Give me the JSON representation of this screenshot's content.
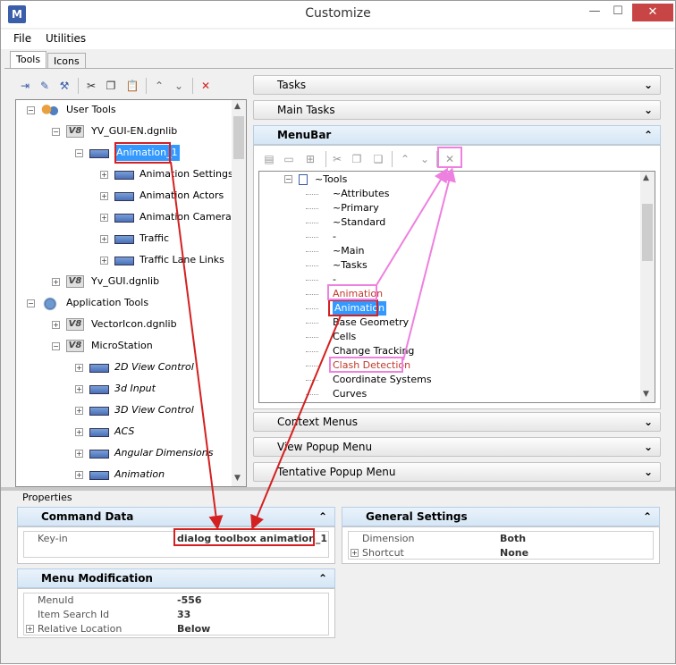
{
  "window": {
    "title": "Customize",
    "minimize": "—",
    "maximize": "☐",
    "close": "✕"
  },
  "menus": [
    "File",
    "Utilities"
  ],
  "tabs": [
    "Tools",
    "Icons"
  ],
  "left_tree": [
    {
      "label": "User Tools",
      "level": 0,
      "icon": "people-icon",
      "expander": "⊟"
    },
    {
      "label": "YV_GUI-EN.dgnlib",
      "level": 1,
      "icon": "v8-icon",
      "expander": "⊟"
    },
    {
      "label": "Animation_1",
      "level": 2,
      "icon": "toolbox-icon",
      "expander": "⊟",
      "selected": true
    },
    {
      "label": "Animation Settings",
      "level": 3,
      "icon": "toolbox-icon",
      "expander": "⊞"
    },
    {
      "label": "Animation Actors",
      "level": 3,
      "icon": "toolbox-icon",
      "expander": "⊞"
    },
    {
      "label": "Animation Cameras",
      "level": 3,
      "icon": "toolbox-icon",
      "expander": "⊞"
    },
    {
      "label": "Traffic",
      "level": 3,
      "icon": "toolbox-icon",
      "expander": "⊞"
    },
    {
      "label": "Traffic Lane Links",
      "level": 3,
      "icon": "toolbox-icon",
      "expander": "⊞"
    },
    {
      "label": "Yv_GUI.dgnlib",
      "level": 1,
      "icon": "v8-icon",
      "expander": "⊞"
    },
    {
      "label": "Application Tools",
      "level": 0,
      "icon": "gear-icon",
      "expander": "⊟"
    },
    {
      "label": "VectorIcon.dgnlib",
      "level": 1,
      "icon": "v8-icon",
      "expander": "⊞"
    },
    {
      "label": "MicroStation",
      "level": 1,
      "icon": "v8-icon",
      "expander": "⊟"
    },
    {
      "label": "2D View Control",
      "level": 2,
      "icon": "toolbox-icon",
      "expander": "⊞",
      "italic": true
    },
    {
      "label": "3d Input",
      "level": 2,
      "icon": "toolbox-icon",
      "expander": "⊞",
      "italic": true
    },
    {
      "label": "3D View Control",
      "level": 2,
      "icon": "toolbox-icon",
      "expander": "⊞",
      "italic": true
    },
    {
      "label": "ACS",
      "level": 2,
      "icon": "toolbox-icon",
      "expander": "⊞",
      "italic": true
    },
    {
      "label": "Angular Dimensions",
      "level": 2,
      "icon": "toolbox-icon",
      "expander": "⊞",
      "italic": true
    },
    {
      "label": "Animation",
      "level": 2,
      "icon": "toolbox-icon",
      "expander": "⊞",
      "italic": true
    }
  ],
  "accordion": {
    "tasks": "Tasks",
    "main_tasks": "Main Tasks",
    "menubar": "MenuBar",
    "context_menus": "Context Menus",
    "view_popup": "View Popup Menu",
    "tentative_popup": "Tentative Popup Menu"
  },
  "menubar_tree": [
    {
      "label": "~Tools",
      "level": 0,
      "expander": "⊟"
    },
    {
      "label": "~Attributes",
      "level": 1
    },
    {
      "label": "~Primary",
      "level": 1
    },
    {
      "label": "~Standard",
      "level": 1
    },
    {
      "label": "-",
      "level": 1
    },
    {
      "label": "~Main",
      "level": 1
    },
    {
      "label": "~Tasks",
      "level": 1
    },
    {
      "label": "-",
      "level": 1
    },
    {
      "label": "Animation",
      "level": 1,
      "color": "#c0392b"
    },
    {
      "label": "Animation",
      "level": 1,
      "selected": true
    },
    {
      "label": "Base Geometry",
      "level": 1
    },
    {
      "label": "Cells",
      "level": 1
    },
    {
      "label": "Change Tracking",
      "level": 1
    },
    {
      "label": "Clash Detection",
      "level": 1,
      "color": "#c0392b"
    },
    {
      "label": "Coordinate Systems",
      "level": 1
    },
    {
      "label": "Curves",
      "level": 1
    }
  ],
  "properties": {
    "label": "Properties",
    "command_data": {
      "title": "Command Data",
      "keyin_label": "Key-in",
      "keyin_value": "dialog toolbox animation_1"
    },
    "menu_modification": {
      "title": "Menu Modification",
      "rows": [
        {
          "name": "MenuId",
          "value": "-556"
        },
        {
          "name": "Item Search Id",
          "value": "33"
        },
        {
          "name": "Relative Location",
          "value": "Below"
        }
      ]
    },
    "general_settings": {
      "title": "General Settings",
      "rows": [
        {
          "name": "Dimension",
          "value": "Both"
        },
        {
          "name": "Shortcut",
          "value": "None"
        }
      ]
    }
  },
  "colors": {
    "accent": "#3399ff",
    "annotation_red": "#d42020",
    "annotation_pink": "#ee80e0"
  }
}
